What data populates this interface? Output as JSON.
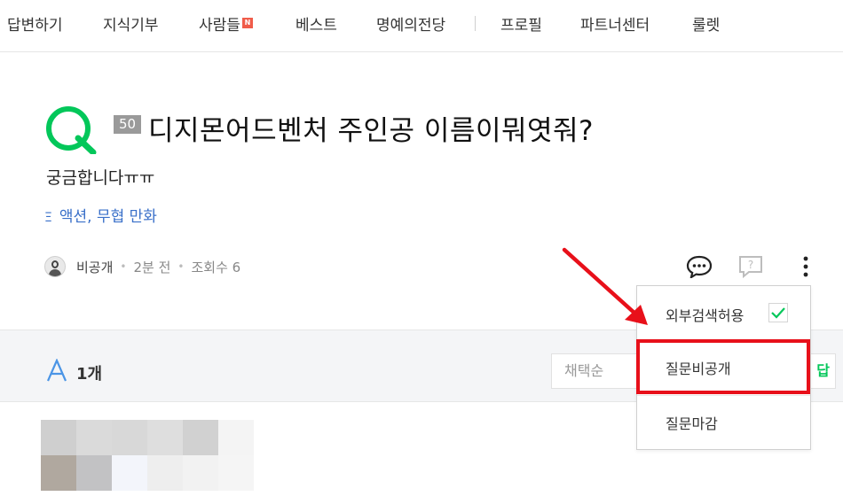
{
  "nav": {
    "items": [
      "답변하기",
      "지식기부",
      "사람들",
      "베스트",
      "명예의전당",
      "프로필",
      "파트너센터",
      "룰렛"
    ],
    "new_badge": "N"
  },
  "question": {
    "points": "50",
    "title": "디지몬어드벤처 주인공 이름이뭐엿줘?",
    "body": "궁금합니다ㅠㅠ",
    "category": "액션, 무협 만화",
    "author": "비공개",
    "time": "2분 전",
    "views": "조회수 6",
    "logo_color": "#03c75a"
  },
  "answers": {
    "count": "1개",
    "sort_placeholder": "채택순",
    "write_label": "답변하기"
  },
  "menu": {
    "items": [
      "외부검색허용",
      "질문비공개",
      "질문마감"
    ],
    "external_search_checked": true,
    "check_color": "#03c75a",
    "highlight_color": "#e8101a"
  }
}
